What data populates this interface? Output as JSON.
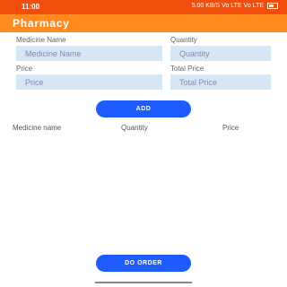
{
  "status_bar": {
    "time": "11:00",
    "indicators": "5.00 KB/S  Vo LTE  Vo LTE",
    "battery_icon": "battery-icon"
  },
  "app_bar": {
    "title": "Pharmacy"
  },
  "form": {
    "medicine_name_label": "Medicine Name",
    "medicine_name_placeholder": "Medicine Name",
    "quantity_label": "Quantity",
    "quantity_placeholder": "Quantity",
    "price_label": "Price",
    "price_placeholder": "Price",
    "total_price_label": "Total Price",
    "total_price_placeholder": "Total Price"
  },
  "add_button": "ADD",
  "table": {
    "headers": [
      "Medicine name",
      "Quantity",
      "Price"
    ]
  },
  "order_button": "DO ORDER",
  "colors": {
    "status_bar": "#f04e0c",
    "app_bar": "#ff8a1f",
    "input_bg": "#d7e6f5",
    "button": "#1f5cff"
  }
}
